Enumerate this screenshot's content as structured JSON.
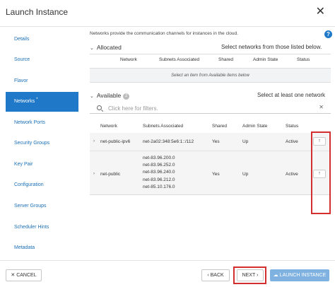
{
  "header": {
    "title": "Launch Instance",
    "close_label": "✕"
  },
  "sidebar": {
    "items": [
      {
        "label": "Details",
        "active": false
      },
      {
        "label": "Source",
        "active": false
      },
      {
        "label": "Flavor",
        "active": false
      },
      {
        "label": "Networks",
        "active": true,
        "required_mark": "*"
      },
      {
        "label": "Network Ports",
        "active": false
      },
      {
        "label": "Security Groups",
        "active": false
      },
      {
        "label": "Key Pair",
        "active": false
      },
      {
        "label": "Configuration",
        "active": false
      },
      {
        "label": "Server Groups",
        "active": false
      },
      {
        "label": "Scheduler Hints",
        "active": false
      },
      {
        "label": "Metadata",
        "active": false
      }
    ]
  },
  "content": {
    "intro": "Networks provide the communication channels for instances in the cloud.",
    "help_label": "?",
    "allocated": {
      "title": "Allocated",
      "hint": "Select networks from those listed below.",
      "columns": [
        "Network",
        "Subnets Associated",
        "Shared",
        "Admin State",
        "Status"
      ],
      "empty_text": "Select an item from Available items below"
    },
    "available": {
      "title": "Available",
      "count": "2",
      "hint": "Select at least one network",
      "filter_placeholder": "Click here for filters.",
      "clear_label": "✕",
      "columns": [
        "Network",
        "Subnets Associated",
        "Shared",
        "Admin State",
        "Status"
      ],
      "rows": [
        {
          "network": "net-public-ipv6",
          "subnets": [
            "net-2a02:348:5e6:1::/112"
          ],
          "shared": "Yes",
          "admin_state": "Up",
          "status": "Active",
          "action": "↑"
        },
        {
          "network": "net-public",
          "subnets": [
            "net-83.96.200.0",
            "net-83.96.252.0",
            "net-83.96.240.0",
            "net-83.96.212.0",
            "net-85.10.176.0"
          ],
          "shared": "Yes",
          "admin_state": "Up",
          "status": "Active",
          "action": "↑"
        }
      ]
    }
  },
  "footer": {
    "cancel_label": "✕ CANCEL",
    "back_label": "‹ BACK",
    "next_label": "NEXT ›",
    "launch_label": "LAUNCH INSTANCE",
    "launch_icon": "cloud-upload-icon"
  },
  "colors": {
    "accent": "#1f78c8",
    "highlight_box": "#d32f2f",
    "launch_disabled": "#7fb2e0"
  }
}
